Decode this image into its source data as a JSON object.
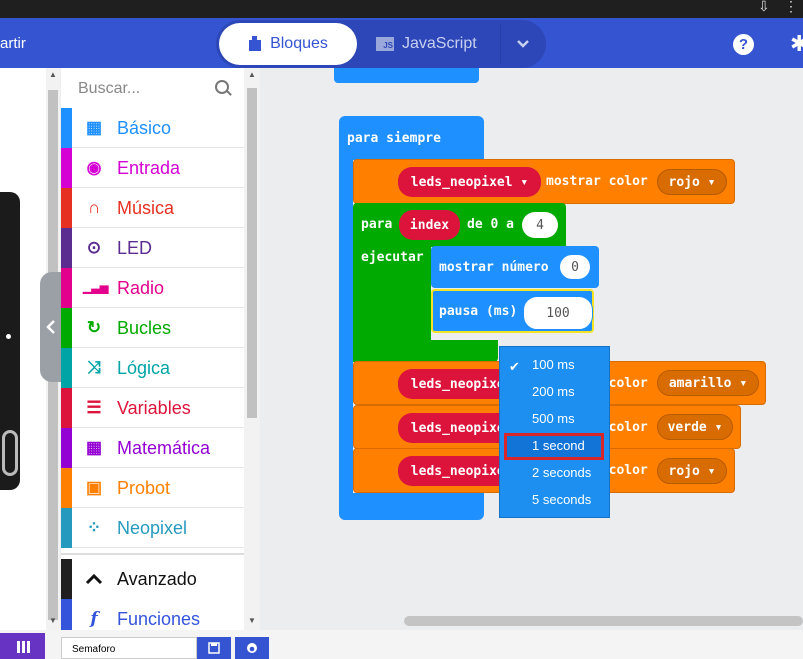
{
  "header": {
    "share_label": "artir",
    "tab_blocks": "Bloques",
    "tab_js": "JavaScript",
    "js_badge": "JS"
  },
  "toolbox": {
    "search_placeholder": "Buscar...",
    "categories": [
      {
        "label": "Básico",
        "color": "#1e90ff",
        "icon": "grid-icon"
      },
      {
        "label": "Entrada",
        "color": "#d400d4",
        "icon": "radio-target-icon"
      },
      {
        "label": "Música",
        "color": "#e63022",
        "icon": "headphones-icon"
      },
      {
        "label": "LED",
        "color": "#5c2d91",
        "icon": "toggle-icon"
      },
      {
        "label": "Radio",
        "color": "#e3008c",
        "icon": "signal-bars-icon"
      },
      {
        "label": "Bucles",
        "color": "#00aa00",
        "icon": "loop-arrow-icon"
      },
      {
        "label": "Lógica",
        "color": "#00a4a6",
        "icon": "shuffle-icon"
      },
      {
        "label": "Variables",
        "color": "#dc143c",
        "icon": "lines-icon"
      },
      {
        "label": "Matemática",
        "color": "#9400d3",
        "icon": "calculator-icon"
      },
      {
        "label": "Probot",
        "color": "#ff8000",
        "icon": "chip-icon"
      },
      {
        "label": "Neopixel",
        "color": "#2699bf",
        "icon": "ring-dots-icon"
      }
    ],
    "advanced": {
      "label": "Avanzado",
      "color": "#000000",
      "icon": "chevron-up-icon"
    },
    "functions": {
      "label": "Funciones",
      "color": "#3455db",
      "icon": "function-icon"
    }
  },
  "workspace": {
    "forever_label": "para siempre",
    "neo_var": "leds_neopixel",
    "show_color": "mostrar color",
    "colors": [
      "rojo",
      "amarillo",
      "verde",
      "rojo"
    ],
    "for_label": "para",
    "index_var": "index",
    "from_label": "de 0 a",
    "for_to": "4",
    "do_label": "ejecutar",
    "show_number_label": "mostrar número",
    "show_number_value": "0",
    "pause_label": "pausa (ms)",
    "pause_value": "100"
  },
  "dropdown": {
    "options": [
      "100 ms",
      "200 ms",
      "500 ms",
      "1 second",
      "2 seconds",
      "5 seconds"
    ],
    "selected": "100 ms",
    "highlighted": "1 second"
  },
  "bottom": {
    "project_name": "Semaforo"
  },
  "colors": {
    "header": "#3454d1",
    "loops": "#00aa00",
    "neopixel": "#ff8000",
    "variables": "#dc143c",
    "basic": "#1e90ff"
  }
}
